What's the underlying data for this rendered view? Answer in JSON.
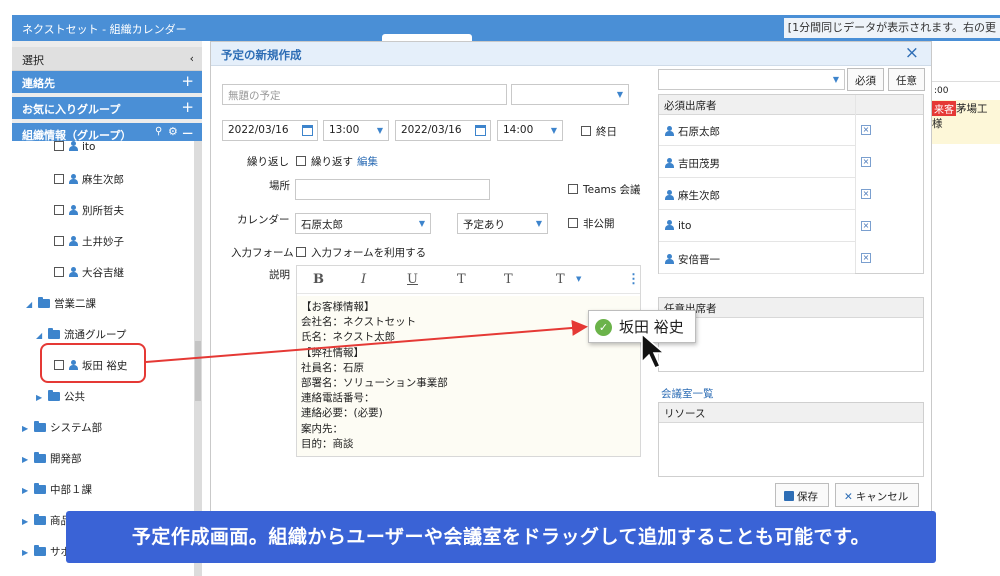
{
  "topbar": {
    "title": "ネクストセット - 組織カレンダー",
    "message": "[1分間同じデータが表示されます。右の更"
  },
  "sidebar": {
    "select_label": "選択",
    "collapse_icon": "‹",
    "contacts": "連絡先",
    "favorites": "お気に入りグループ",
    "org": "組織情報（グループ）",
    "plus": "+",
    "minus": "−",
    "tree": {
      "ito": "ito",
      "aso": "麻生次郎",
      "bessho": "別所哲夫",
      "doi": "土井妙子",
      "otani": "大谷吉継",
      "eigyo2": "営業二課",
      "ryutsu": "流通グループ",
      "sakata": "坂田 裕史",
      "kokyo": "公共",
      "system": "システム部",
      "kaihatsu": "開発部",
      "chubu": "中部１課",
      "shoho": "商品",
      "sapo": "サポ"
    }
  },
  "dialog": {
    "title": "予定の新規作成",
    "close_icon": "×",
    "subject_placeholder": "無題の予定",
    "start_date": "2022/03/16",
    "start_time": "13:00",
    "end_date": "2022/03/16",
    "end_time": "14:00",
    "allday": "終日",
    "repeat_label": "繰り返し",
    "repeat_check": "繰り返す",
    "edit_link": "編集",
    "place_label": "場所",
    "teams": "Teams 会議",
    "calendar_label": "カレンダー",
    "calendar_value": "石原太郎",
    "status_value": "予定あり",
    "private": "非公開",
    "form_label": "入力フォーム",
    "form_check": "入力フォームを利用する",
    "desc_label": "説明",
    "toolbar": {
      "bold": "B",
      "italic": "I",
      "underline": "U",
      "sup": "T",
      "sub": "T",
      "size": "T",
      "more": "⋮"
    },
    "description_lines": [
      "【お客様情報】",
      "会社名：ネクストセット",
      "氏名：ネクスト太郎",
      "【弊社情報】",
      "社員名：石原",
      "部署名：ソリューション事業部",
      "連絡電話番号：",
      "連絡必要：(必要)",
      "案内先：",
      "目的：商談"
    ],
    "required_btn": "必須",
    "optional_btn": "任意",
    "required_header": "必須出席者",
    "required_attendees": [
      "石原太郎",
      "吉田茂男",
      "麻生次郎",
      "ito",
      "安倍晋一"
    ],
    "optional_header": "任意出席者",
    "rooms_link": "会議室一覧",
    "resource_header": "リソース",
    "save": "保存",
    "cancel": "キャンセル"
  },
  "background_calendar": {
    "time": ":00",
    "badge": "来客",
    "text1": "茅場工",
    "text2": "様"
  },
  "drag_tip": {
    "name": "坂田 裕史"
  },
  "caption": "予定作成画面。組織からユーザーや会議室をドラッグして追加することも可能です。"
}
